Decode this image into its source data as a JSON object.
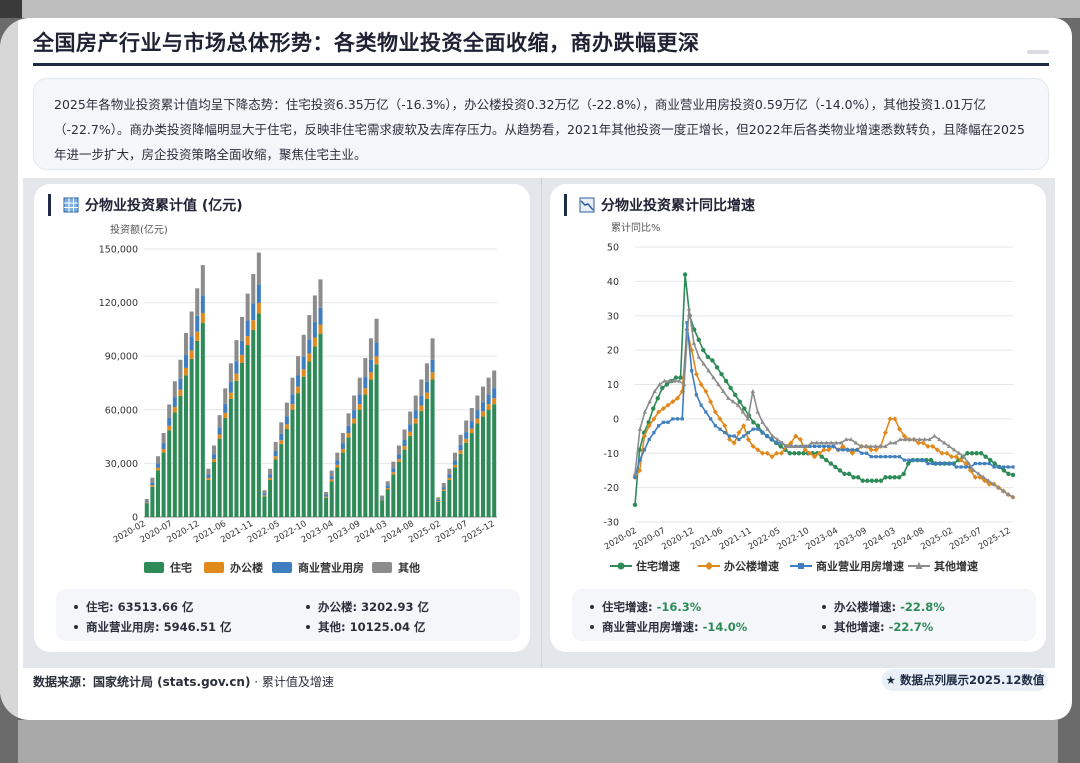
{
  "title": "全国房产行业与市场总体形势：各类物业投资全面收缩，商办跌幅更深",
  "summary": "2025年各物业投资累计值均呈下降态势：住宅投资6.35万亿（-16.3%），办公楼投资0.32万亿（-22.8%），商业营业用房投资0.59万亿（-14.0%），其他投资1.01万亿（-22.7%）。商办类投资降幅明显大于住宅，反映非住宅需求疲软及去库存压力。从趋势看，2021年其他投资一度正增长，但2022年后各类物业增速悉数转负，且降幅在2025年进一步扩大，房企投资策略全面收缩，聚焦住宅主业。",
  "colors": {
    "residential": "#2e8b57",
    "office": "#e08a1e",
    "commercial": "#3f7fbf",
    "other": "#8c8c8c"
  },
  "left_panel": {
    "title": "分物业投资累计值 (亿元)",
    "icon": "grid-table-icon",
    "stats": [
      {
        "label": "住宅:",
        "value": "63513.66 亿"
      },
      {
        "label": "办公楼:",
        "value": "3202.93 亿"
      },
      {
        "label": "商业营业用房:",
        "value": "5946.51 亿"
      },
      {
        "label": "其他:",
        "value": "10125.04 亿"
      }
    ]
  },
  "right_panel": {
    "title": "分物业投资累计同比增速",
    "icon": "line-chart-icon",
    "stats": [
      {
        "label": "住宅增速:",
        "value": "-16.3%"
      },
      {
        "label": "办公楼增速:",
        "value": "-22.8%"
      },
      {
        "label": "商业营业用房增速:",
        "value": "-14.0%"
      },
      {
        "label": "其他增速:",
        "value": "-22.7%"
      }
    ]
  },
  "footer": {
    "source": "数据来源：国家统计局 (stats.gov.cn)",
    "note": "累计值及增速",
    "badge": "★ 数据点列展示2025.12数值"
  },
  "chart_data": [
    {
      "type": "bar",
      "stacked": true,
      "ylabel": "投资额(亿元)",
      "ylim": [
        0,
        150000
      ],
      "yticks": [
        "0",
        "30,000",
        "60,000",
        "90,000",
        "120,000",
        "150,000"
      ],
      "ytick_values": [
        0,
        30000,
        60000,
        90000,
        120000,
        150000
      ],
      "xtick_labels": [
        "2020-02",
        "2020-07",
        "2020-12",
        "2021-06",
        "2021-11",
        "2022-05",
        "2022-10",
        "2023-04",
        "2023-09",
        "2024-03",
        "2024-08",
        "2025-02",
        "2025-07",
        "2025-12"
      ],
      "legend": [
        "住宅",
        "办公楼",
        "商业营业用房",
        "其他"
      ],
      "legend_position": "bottom",
      "grid": true,
      "totals": [
        [
          10100,
          22000,
          34000,
          47000,
          63000,
          76000,
          88000,
          103000,
          115000,
          128000,
          141000
        ],
        [
          27000,
          40000,
          57000,
          72000,
          86000,
          99000,
          112000,
          125000,
          136000,
          148000
        ],
        [
          15000,
          27000,
          42000,
          53000,
          64000,
          78000,
          90000,
          102000,
          113000,
          124000,
          133000
        ],
        [
          14000,
          26000,
          36000,
          47000,
          58000,
          68000,
          78000,
          89000,
          100000,
          111000
        ],
        [
          12000,
          20000,
          31000,
          40000,
          49000,
          59000,
          68000,
          77000,
          86000,
          100000
        ],
        [
          11000,
          19000,
          27000,
          36000,
          46000,
          54000,
          61000,
          68000,
          73000,
          78000,
          82000
        ]
      ],
      "share": {
        "residential": 0.77,
        "office": 0.04,
        "commercial": 0.07,
        "other": 0.12
      }
    },
    {
      "type": "line",
      "ylabel": "累计同比%",
      "ylim": [
        -30,
        50
      ],
      "yticks": [
        "-30",
        "-20",
        "-10",
        "0",
        "10",
        "20",
        "30",
        "40",
        "50"
      ],
      "ytick_values": [
        -30,
        -20,
        -10,
        0,
        10,
        20,
        30,
        40,
        50
      ],
      "xtick_labels": [
        "2020-02",
        "2020-07",
        "2020-12",
        "2021-06",
        "2021-11",
        "2022-05",
        "2022-10",
        "2023-04",
        "2023-09",
        "2024-03",
        "2024-08",
        "2025-02",
        "2025-07",
        "2025-12"
      ],
      "legend_position": "bottom",
      "grid": true,
      "series": [
        {
          "name": "住宅增速",
          "color": "#2e8b57",
          "marker": "circle",
          "values": [
            -25,
            -9,
            -4,
            -1,
            3,
            6,
            9,
            10,
            11,
            12,
            12,
            42,
            30,
            26,
            23,
            20,
            18,
            17,
            15,
            13,
            11,
            9,
            7,
            5,
            3,
            1,
            -1,
            -2,
            -4,
            -5,
            -6,
            -7,
            -8,
            -9,
            -10,
            -10,
            -10,
            -10,
            -10,
            -10,
            -10,
            -11,
            -12,
            -13,
            -14,
            -15,
            -16,
            -16,
            -17,
            -17,
            -18,
            -18,
            -18,
            -18,
            -18,
            -17,
            -17,
            -17,
            -17,
            -16,
            -13,
            -12,
            -12,
            -12,
            -12,
            -12,
            -13,
            -13,
            -13,
            -13,
            -13,
            -12,
            -11,
            -10,
            -10,
            -10,
            -10,
            -11,
            -12,
            -13,
            -14,
            -15,
            -16,
            -16.3
          ]
        },
        {
          "name": "办公楼增速",
          "color": "#e08a1e",
          "marker": "diamond",
          "values": [
            -17,
            -15,
            -5,
            -2,
            0,
            2,
            3,
            4,
            5,
            6,
            8,
            26,
            20,
            13,
            10,
            8,
            5,
            2,
            0,
            -2,
            -6,
            -7,
            -4,
            -2,
            -6,
            -8,
            -9,
            -10,
            -10,
            -11,
            -10,
            -10,
            -8,
            -7,
            -5,
            -6,
            -9,
            -10,
            -11,
            -10,
            -9,
            -9,
            -8,
            -9,
            -8,
            -9,
            -10,
            -9,
            -8,
            -8,
            -9,
            -9,
            -8,
            -4,
            0,
            0,
            -3,
            -5,
            -6,
            -6,
            -7,
            -7,
            -8,
            -8,
            -9,
            -10,
            -10,
            -11,
            -11,
            -12,
            -13,
            -15,
            -17,
            -17,
            -18,
            -19,
            -19,
            -20,
            -21,
            -22,
            -22.8
          ]
        },
        {
          "name": "商业营业用房增速",
          "color": "#3f7fbf",
          "marker": "square",
          "values": [
            -17,
            -12,
            -9,
            -6,
            -4,
            -2,
            -1,
            -1,
            0,
            0,
            0,
            28,
            14,
            7,
            4,
            2,
            0,
            -2,
            -3,
            -4,
            -5,
            -5,
            -6,
            -5,
            -4,
            -3,
            -3,
            -4,
            -5,
            -6,
            -7,
            -7,
            -8,
            -8,
            -8,
            -8,
            -8,
            -8,
            -8,
            -8,
            -8,
            -8,
            -8,
            -9,
            -9,
            -9,
            -9,
            -9,
            -10,
            -10,
            -11,
            -11,
            -11,
            -11,
            -11,
            -11,
            -11,
            -12,
            -12,
            -12,
            -12,
            -12,
            -13,
            -13,
            -13,
            -13,
            -13,
            -13,
            -14,
            -14,
            -14,
            -14,
            -13,
            -13,
            -13,
            -13,
            -14,
            -14,
            -14,
            -14,
            -14.0
          ]
        },
        {
          "name": "其他增速",
          "color": "#8c8c8c",
          "marker": "triangle",
          "values": [
            -16,
            -3,
            2,
            5,
            8,
            10,
            11,
            11,
            11,
            11,
            10,
            32,
            22,
            18,
            16,
            14,
            12,
            10,
            8,
            6,
            5,
            4,
            2,
            0,
            8,
            2,
            -1,
            -3,
            -5,
            -6,
            -7,
            -8,
            -8,
            -8,
            -8,
            -8,
            -7,
            -7,
            -7,
            -7,
            -7,
            -7,
            -7,
            -6,
            -6,
            -7,
            -8,
            -8,
            -8,
            -8,
            -8,
            -8,
            -7,
            -7,
            -6,
            -6,
            -6,
            -6,
            -6,
            -6,
            -6,
            -5,
            -6,
            -7,
            -8,
            -9,
            -10,
            -11,
            -13,
            -15,
            -16,
            -17,
            -18,
            -19,
            -20,
            -21,
            -22,
            -22.7
          ]
        }
      ]
    }
  ]
}
